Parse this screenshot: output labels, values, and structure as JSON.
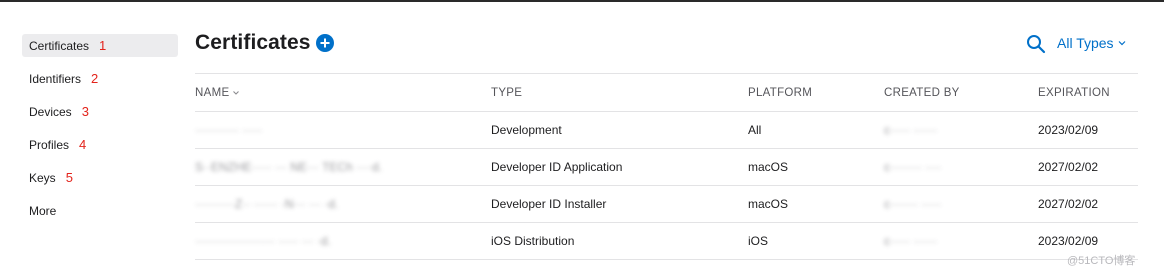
{
  "sidebar": {
    "items": [
      {
        "label": "Certificates",
        "annotation": "1"
      },
      {
        "label": "Identifiers",
        "annotation": "2"
      },
      {
        "label": "Devices",
        "annotation": "3"
      },
      {
        "label": "Profiles",
        "annotation": "4"
      },
      {
        "label": "Keys",
        "annotation": "5"
      },
      {
        "label": "More",
        "annotation": ""
      }
    ],
    "active_index": 0
  },
  "header": {
    "title": "Certificates",
    "add_icon": "plus-circle-icon",
    "search_icon": "search-icon",
    "filter_label": "All Types"
  },
  "table": {
    "columns": [
      "NAME",
      "TYPE",
      "PLATFORM",
      "CREATED BY",
      "EXPIRATION"
    ],
    "rows": [
      {
        "name": "··········· ·····",
        "type": "Development",
        "platform": "All",
        "created_by": "c····· ······",
        "expiration": "2023/02/09"
      },
      {
        "name": "S··ENZHE····· ··· NE··· TECh ····d.",
        "type": "Developer ID Application",
        "platform": "macOS",
        "created_by": "c········ ····",
        "expiration": "2027/02/02"
      },
      {
        "name": "··········Z·· ······ ·N··· ··· ·d.",
        "type": "Developer ID Installer",
        "platform": "macOS",
        "created_by": "c······· ·····",
        "expiration": "2027/02/02"
      },
      {
        "name": "···················· ····· ··· ·d.",
        "type": "iOS Distribution",
        "platform": "iOS",
        "created_by": "c····· ······",
        "expiration": "2023/02/09"
      }
    ]
  },
  "colors": {
    "accent": "#0070c9",
    "annotation": "#e3231b",
    "active_bg": "#ececee"
  },
  "watermark": "@51CTO博客"
}
